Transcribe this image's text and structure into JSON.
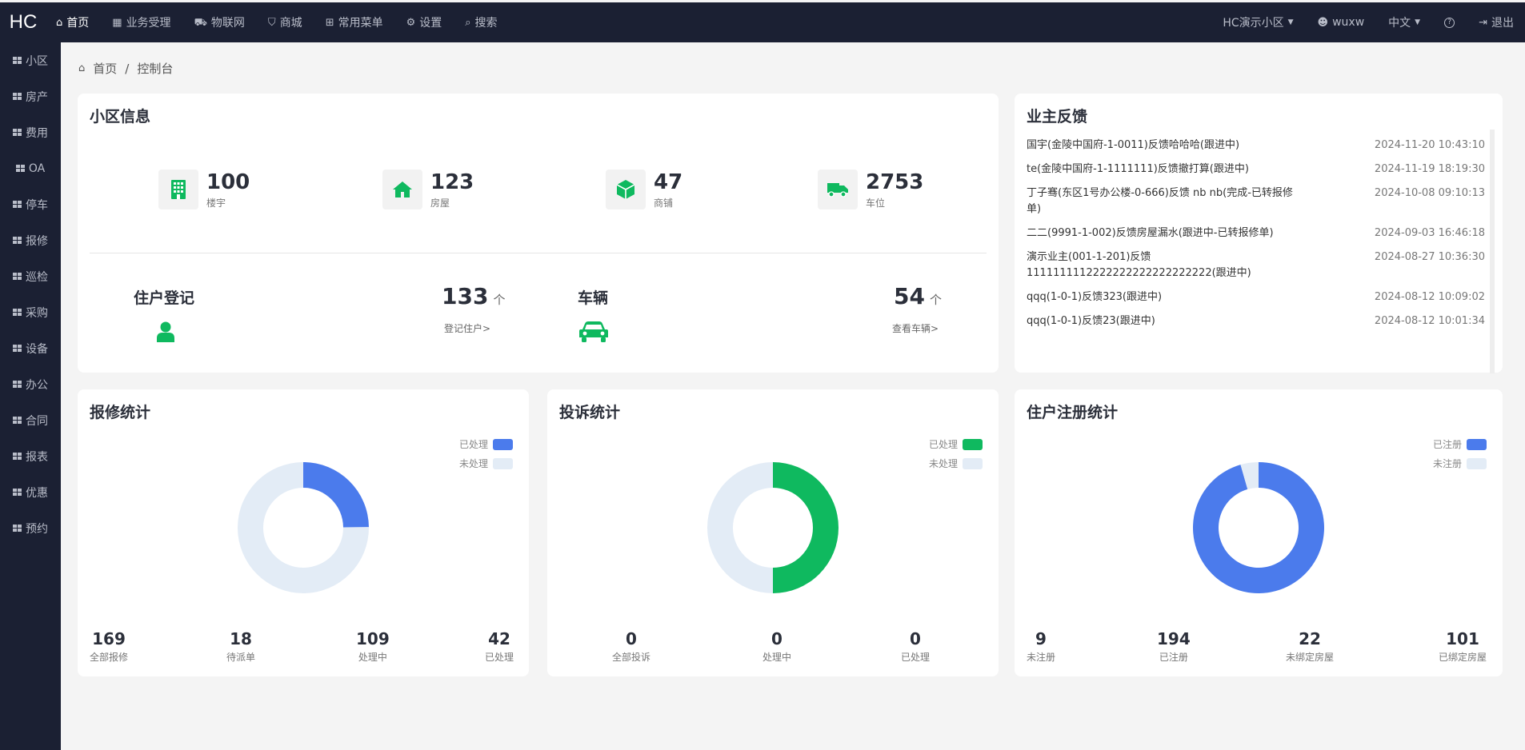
{
  "app": {
    "logo": "HC"
  },
  "nav": {
    "items": [
      {
        "label": "首页",
        "icon": "home-icon"
      },
      {
        "label": "业务受理",
        "icon": "calculator-icon"
      },
      {
        "label": "物联网",
        "icon": "car-icon"
      },
      {
        "label": "商城",
        "icon": "cart-icon"
      },
      {
        "label": "常用菜单",
        "icon": "sitemap-icon"
      },
      {
        "label": "设置",
        "icon": "gear-icon"
      },
      {
        "label": "搜索",
        "icon": "search-icon"
      }
    ],
    "community": "HC演示小区",
    "user": "wuxw",
    "language": "中文",
    "logout": "退出"
  },
  "sidebar": {
    "items": [
      "小区",
      "房产",
      "费用",
      "OA",
      "停车",
      "报修",
      "巡检",
      "采购",
      "设备",
      "办公",
      "合同",
      "报表",
      "优惠",
      "预约"
    ]
  },
  "breadcrumb": {
    "home": "首页",
    "sep": "/",
    "current": "控制台"
  },
  "community_info": {
    "title": "小区信息",
    "stats": [
      {
        "value": "100",
        "label": "楼宇",
        "icon": "building-icon"
      },
      {
        "value": "123",
        "label": "房屋",
        "icon": "house-icon"
      },
      {
        "value": "47",
        "label": "商铺",
        "icon": "box-icon"
      },
      {
        "value": "2753",
        "label": "车位",
        "icon": "truck-icon"
      }
    ],
    "resident": {
      "title": "住户登记",
      "count": "133",
      "unit": "个",
      "link": "登记住户>"
    },
    "vehicle": {
      "title": "车辆",
      "count": "54",
      "unit": "个",
      "link": "查看车辆>"
    }
  },
  "feedback": {
    "title": "业主反馈",
    "items": [
      {
        "text": "国宇(金陵中国府-1-0011)反馈哈哈哈(跟进中)",
        "time": "2024-11-20 10:43:10"
      },
      {
        "text": "te(金陵中国府-1-1111111)反馈撤打算(跟进中)",
        "time": "2024-11-19 18:19:30"
      },
      {
        "text": "丁子骞(东区1号办公楼-0-666)反馈 nb nb(完成-已转报修单)",
        "time": "2024-10-08 09:10:13"
      },
      {
        "text": "二二(9991-1-002)反馈房屋漏水(跟进中-已转报修单)",
        "time": "2024-09-03 16:46:18"
      },
      {
        "text": "演示业主(001-1-201)反馈1111111112222222222222222222(跟进中)",
        "time": "2024-08-27 10:36:30"
      },
      {
        "text": "qqq(1-0-1)反馈323(跟进中)",
        "time": "2024-08-12 10:09:02"
      },
      {
        "text": "qqq(1-0-1)反馈23(跟进中)",
        "time": "2024-08-12 10:01:34"
      }
    ]
  },
  "repair": {
    "title": "报修统计",
    "legend": [
      "已处理",
      "未处理"
    ],
    "stats": [
      {
        "value": "169",
        "label": "全部报修"
      },
      {
        "value": "18",
        "label": "待派单"
      },
      {
        "value": "109",
        "label": "处理中"
      },
      {
        "value": "42",
        "label": "已处理"
      }
    ]
  },
  "complaint": {
    "title": "投诉统计",
    "legend": [
      "已处理",
      "未处理"
    ],
    "stats": [
      {
        "value": "0",
        "label": "全部投诉"
      },
      {
        "value": "0",
        "label": "处理中"
      },
      {
        "value": "0",
        "label": "已处理"
      }
    ]
  },
  "register": {
    "title": "住户注册统计",
    "legend": [
      "已注册",
      "未注册"
    ],
    "stats": [
      {
        "value": "9",
        "label": "未注册"
      },
      {
        "value": "194",
        "label": "已注册"
      },
      {
        "value": "22",
        "label": "未绑定房屋"
      },
      {
        "value": "101",
        "label": "已绑定房屋"
      }
    ]
  },
  "chart_data": [
    {
      "type": "pie",
      "title": "报修统计",
      "series": [
        {
          "name": "已处理",
          "value": 42
        },
        {
          "name": "未处理",
          "value": 127
        }
      ]
    },
    {
      "type": "pie",
      "title": "投诉统计",
      "series": [
        {
          "name": "已处理",
          "value": 1
        },
        {
          "name": "未处理",
          "value": 1
        }
      ]
    },
    {
      "type": "pie",
      "title": "住户注册统计",
      "series": [
        {
          "name": "已注册",
          "value": 194
        },
        {
          "name": "未注册",
          "value": 9
        }
      ]
    }
  ],
  "colors": {
    "nav_bg": "#1b2033",
    "accent_green": "#0fb95f",
    "blue": "#4b7bec",
    "light": "#e3ecf6"
  }
}
